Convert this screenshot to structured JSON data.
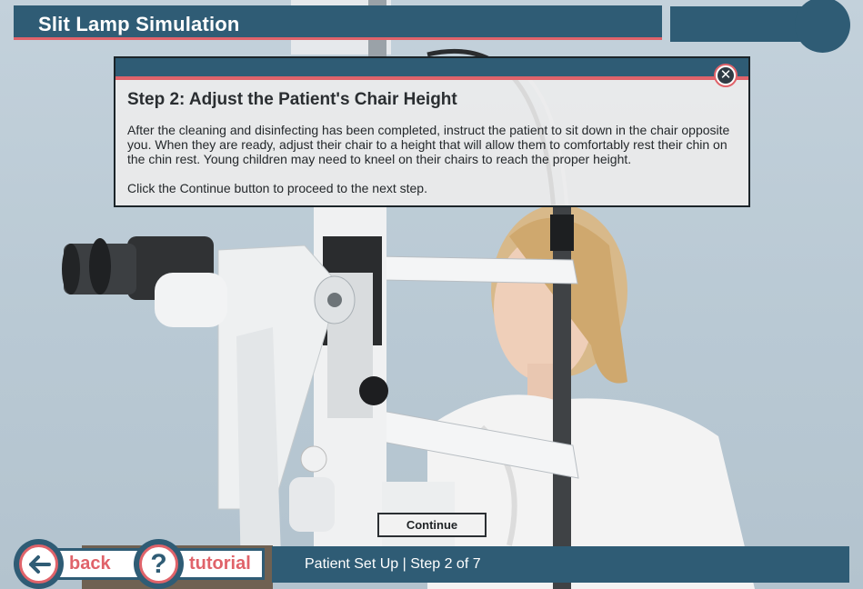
{
  "header": {
    "title": "Slit Lamp Simulation"
  },
  "dialog": {
    "title": "Step 2: Adjust the Patient's Chair Height",
    "body_paragraph_1": "After the cleaning and disinfecting has been completed, instruct the patient to sit down in the chair opposite you. When they are ready, adjust their chair to a height that will allow them to comfortably rest their chin on the chin rest. Young children may need to kneel on their chairs to reach the proper height.",
    "body_paragraph_2": "Click the Continue button to proceed to the next step.",
    "close_icon": "close-icon"
  },
  "continue_button": {
    "label": "Continue"
  },
  "nav": {
    "back_label": "back",
    "back_icon": "arrow-left-icon",
    "tutorial_label": "tutorial",
    "tutorial_icon": "question-mark-icon",
    "tutorial_glyph": "?"
  },
  "status": {
    "text": "Patient Set Up | Step 2 of 7"
  },
  "colors": {
    "primary": "#2f5c75",
    "accent": "#e0636a",
    "background": "#bccbd6"
  }
}
